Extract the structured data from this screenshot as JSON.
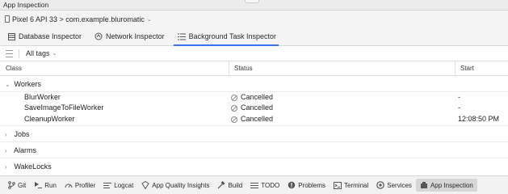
{
  "window": {
    "title": "App Inspection"
  },
  "device": {
    "selector_label": "Pixel 6 API 33 > com.example.bluromatic"
  },
  "tabs": [
    {
      "label": "Database Inspector",
      "icon": "table-icon"
    },
    {
      "label": "Network Inspector",
      "icon": "network-icon"
    },
    {
      "label": "Background Task Inspector",
      "icon": "list-icon",
      "active": true
    }
  ],
  "filter": {
    "tags_label": "All tags"
  },
  "table": {
    "columns": {
      "class": "Class",
      "status": "Status",
      "start": "Start"
    },
    "groups": {
      "workers": "Workers",
      "jobs": "Jobs",
      "alarms": "Alarms",
      "wakelocks": "WakeLocks"
    },
    "workers": [
      {
        "class": "BlurWorker",
        "status": "Cancelled",
        "start": "-"
      },
      {
        "class": "SaveImageToFileWorker",
        "status": "Cancelled",
        "start": "-"
      },
      {
        "class": "CleanupWorker",
        "status": "Cancelled",
        "start": "12:08:50 PM"
      }
    ]
  },
  "bottom_tools": {
    "git": "Git",
    "run": "Run",
    "profiler": "Profiler",
    "logcat": "Logcat",
    "app_quality": "App Quality Insights",
    "build": "Build",
    "todo": "TODO",
    "problems": "Problems",
    "terminal": "Terminal",
    "services": "Services",
    "app_inspection": "App Inspection"
  },
  "colors": {
    "accent": "#3574f0",
    "background": "#f4f4f4"
  }
}
